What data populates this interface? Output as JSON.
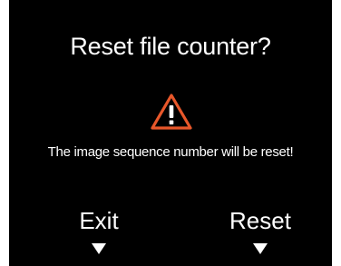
{
  "dialog": {
    "title": "Reset file counter?",
    "icon": "warning-triangle-icon",
    "message": "The image sequence number will be reset!",
    "accent_color": "#e8572a"
  },
  "softkeys": {
    "left_label": "Exit",
    "right_label": "Reset",
    "arrow_icon": "triangle-down-icon"
  }
}
